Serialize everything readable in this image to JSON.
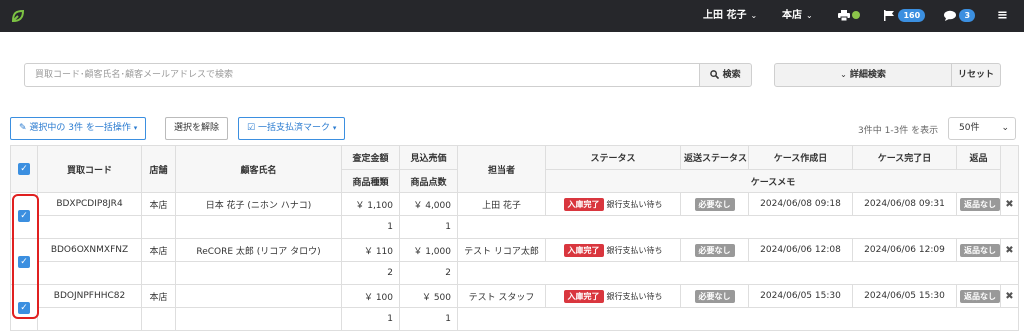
{
  "topbar": {
    "user_name": "上田 花子",
    "store_name": "本店",
    "notifications_count": "160",
    "messages_count": "3",
    "icons": [
      "logo-icon",
      "printer-icon",
      "flag-icon",
      "chat-icon",
      "menu-icon"
    ]
  },
  "search": {
    "placeholder": "買取コード･顧客氏名･顧客メールアドレスで検索",
    "search_label": "検索",
    "advanced_label": "詳細検索",
    "reset_label": "リセット"
  },
  "actions": {
    "bulk_label": "選択中の 3件 を一括操作",
    "deselect_label": "選択を解除",
    "paid_mark_label": "一括支払済マーク",
    "count_text": "3件中 1-3件 を表示",
    "per_page": "50件"
  },
  "table": {
    "headers": [
      "買取コード",
      "店舗",
      "顧客氏名",
      "査定金額",
      "見込売価",
      "担当者",
      "ステータス",
      "返送ステータス",
      "ケース作成日",
      "ケース完了日",
      "返品"
    ],
    "sub_headers": {
      "amount_sub": "商品種類",
      "price_sub": "商品点数",
      "memo": "ケースメモ"
    },
    "rows": [
      {
        "code": "BDXPCDIP8JR4",
        "store": "本店",
        "customer": "日本 花子 (ニホン ハナコ)",
        "amount": "￥ 1,100",
        "price": "￥ 4,000",
        "staff": "上田 花子",
        "status_badge": "入庫完了",
        "status_text": "銀行支払い待ち",
        "return_status": "必要なし",
        "created": "2024/06/08 09:18",
        "completed": "2024/06/08 09:31",
        "returns": "返品なし",
        "types": "1",
        "items": "1"
      },
      {
        "code": "BDO6OXNMXFNZ",
        "store": "本店",
        "customer": "ReCORE 太郎 (リコア タロウ)",
        "amount": "￥ 110",
        "price": "￥ 1,000",
        "staff": "テスト リコア太郎",
        "status_badge": "入庫完了",
        "status_text": "銀行支払い待ち",
        "return_status": "必要なし",
        "created": "2024/06/06 12:08",
        "completed": "2024/06/06 12:09",
        "returns": "返品なし",
        "types": "2",
        "items": "2"
      },
      {
        "code": "BDOJNPFHHC82",
        "store": "本店",
        "customer": "",
        "amount": "￥ 100",
        "price": "￥ 500",
        "staff": "テスト スタッフ",
        "status_badge": "入庫完了",
        "status_text": "銀行支払い待ち",
        "return_status": "必要なし",
        "created": "2024/06/05 15:30",
        "completed": "2024/06/05 15:30",
        "returns": "返品なし",
        "types": "1",
        "items": "1"
      }
    ]
  },
  "colors": {
    "accent": "#3b8fe0",
    "status_red": "#d9363e",
    "badge_gray": "#999999",
    "topbar": "#26272b",
    "highlight": "#e02020"
  }
}
